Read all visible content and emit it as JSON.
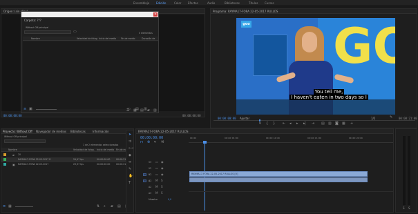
{
  "workspaces": [
    "Ensamblaje",
    "Edición",
    "Color",
    "Efectos",
    "Audio",
    "Bibliotecas",
    "Títulos",
    "Cursos"
  ],
  "source_panel": {
    "label": "Origen: (sin clips)",
    "timecode_left": "00:00:00:00",
    "timecode_right": "00:00:00:00"
  },
  "dialog": {
    "title": "Carpeta: ???",
    "search_path": "Without Off-principal",
    "count": "0 elementos",
    "columns": [
      "Nombre",
      "Velocidad de fotog.",
      "Inicio del medio",
      "Fin de medio",
      "Duración de"
    ]
  },
  "program_panel": {
    "label": "Programa: RAYMA17-FORA 22-05-2017 RULLOS",
    "timecode_left": "00:00:00:00",
    "fit_label": "Ajustar",
    "quality_label": "1/2",
    "timecode_right": "00:00:21:00",
    "subtitle_line1": "You tell me,",
    "subtitle_line2": "I haven't eaten in two days so I",
    "bug_text": "goo",
    "bg_letters": "GO"
  },
  "project_panel": {
    "tabs": [
      "Proyecto: Without Off",
      "Navegador de medios",
      "Bibliotecas",
      "Información"
    ],
    "path": "Without Off-principal",
    "selection_info": "1 de 2 elementos seleccionados",
    "columns": [
      "Nombre",
      "Velocidad de fotog.",
      "Inicio del medio",
      "Fin de medio"
    ],
    "items": [
      {
        "name": "20",
        "fps": "",
        "start": "",
        "end": "",
        "color": "#d89c2b"
      },
      {
        "name": "RAYMA17-FORA 22-05-2017 R",
        "fps": "29,97 fps",
        "start": "00:00:00:00",
        "end": "00:00:21:03",
        "color": "#39b25c"
      },
      {
        "name": "RAYMA17-FORA 22-05-2017",
        "fps": "29,97 fps",
        "start": "00:00:00:00",
        "end": "00:00:21:03",
        "color": "#2fa7a2"
      }
    ]
  },
  "timeline": {
    "tab": "RAYMA17-FORA 22-05-2017 RULLOS",
    "timecode": "00:00:00:00",
    "ruler_marks": [
      "00:00",
      "00:00:05:00",
      "00:00:10:00",
      "00:00:15:00",
      "00:00:20:00"
    ],
    "video_tracks": [
      "V3",
      "V2",
      "V1"
    ],
    "audio_tracks": [
      "A1",
      "A2",
      "A3"
    ],
    "clip_label": "RAYMA17-FORA 22-05-2017 RULLOS [V]",
    "master_label": "Maestro",
    "master_value": "0,0"
  }
}
